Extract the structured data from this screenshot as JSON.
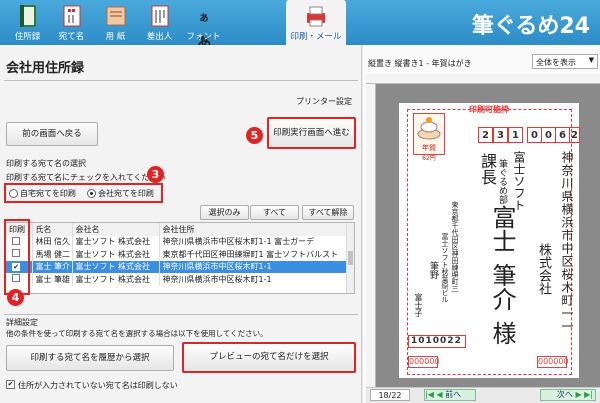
{
  "toolbar": {
    "tabs": [
      {
        "label": "住所録",
        "icon": "address-book-icon"
      },
      {
        "label": "宛て名",
        "icon": "envelope-icon"
      },
      {
        "label": "用 紙",
        "icon": "paper-icon"
      },
      {
        "label": "差出人",
        "icon": "sender-icon"
      },
      {
        "label": "フォント",
        "icon": "font-icon"
      },
      {
        "label": "印刷・メール",
        "icon": "printer-mail-icon"
      }
    ],
    "font_glyph": "あ",
    "font_glyph_small": "あ",
    "logo": "筆ぐるめ24"
  },
  "left": {
    "title": "会社用住所録",
    "printer_settings": "プリンター設定",
    "back_button": "前の画面へ戻る",
    "print_run_button": "印刷実行画面へ進む",
    "badges": [
      "5",
      "3",
      "4"
    ],
    "select_section": {
      "heading": "印刷する宛て名の選択",
      "instruction": "印刷する宛て名にチェックを入れてください",
      "radio_home": "自宅宛てを印刷",
      "radio_company": "会社宛てを印刷",
      "btn_only": "選択のみ",
      "btn_all": "すべて",
      "btn_clear": "すべて解除"
    },
    "table": {
      "headers": [
        "印刷",
        "氏名",
        "会社名",
        "会社住所"
      ],
      "rows": [
        {
          "checked": false,
          "name": "林田 信久",
          "company": "富士ソフト 株式会社",
          "address": "神奈川県横浜市中区桜木町1-1 富士ガーデ"
        },
        {
          "checked": false,
          "name": "馬場 健二",
          "company": "富士ソフト 株式会社",
          "address": "東京都千代田区神田練塀町1 富士ソフトバルスト"
        },
        {
          "checked": true,
          "name": "富士 筆介",
          "company": "富士ソフト 株式会社",
          "address": "神奈川県横浜市中区桜木町1-1"
        },
        {
          "checked": false,
          "name": "富士 筆雄",
          "company": "富士ソフト 株式会社",
          "address": "神奈川県横浜市中区桜木町1-1"
        }
      ],
      "check_mark": "✔"
    },
    "detail": {
      "heading": "詳細設定",
      "note": "他の条件を使って印刷する宛て名を選択する場合は以下を使用してください。",
      "history_button": "印刷する宛て名を履歴から選択",
      "preview_only_button": "プレビューの宛て名だけを選択",
      "skip_checkbox": "住所が入力されていない宛て名は印刷しない",
      "check_mark": "✔"
    }
  },
  "right": {
    "info": "縦置き 縦書き1 - 年賀はがき",
    "zoom": "全体を表示",
    "printable_label": "印刷可能枠",
    "postcard": {
      "zip": [
        "2",
        "3",
        "1",
        "0",
        "0",
        "6",
        "2"
      ],
      "address": "神奈川県横浜市中区桜木町一一",
      "company_line1": "株式会社",
      "company_name": "富士ソフト",
      "dept": "筆ぐるめ部",
      "title": "課長",
      "name_surname": "富士",
      "name_given": "筆介",
      "honorific": "様",
      "sender_addr": "東京都千代田区神田練塀町三",
      "sender_bldg": "富士ソフト秋葉原ビル",
      "sender_name1": "筆野",
      "sender_name2": "富士子",
      "sender_zip": "1010022",
      "stamp_text": "年賀",
      "stamp_sub": "62円",
      "lottery": "000000"
    },
    "page_indicator": "18/22",
    "prev": "前へ",
    "next": "次へ"
  }
}
